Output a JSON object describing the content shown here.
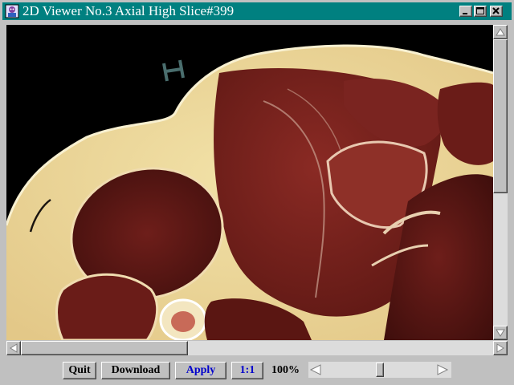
{
  "window": {
    "title": "2D Viewer No.3 Axial High Slice#399",
    "controls": [
      "minimize-icon",
      "maximize-icon",
      "close-icon"
    ],
    "title_bar_color": "#008080"
  },
  "viewer": {
    "content": "axial cross-section image",
    "background": "#000000"
  },
  "toolbar": {
    "quit_label": "Quit",
    "download_label": "Download",
    "apply_label": "Apply",
    "ratio_label": "1:1",
    "zoom_label": "100%",
    "zoom_slider_position": 0.5
  },
  "scrollbars": {
    "horizontal_position": 0.0,
    "vertical_position": 0.0
  }
}
